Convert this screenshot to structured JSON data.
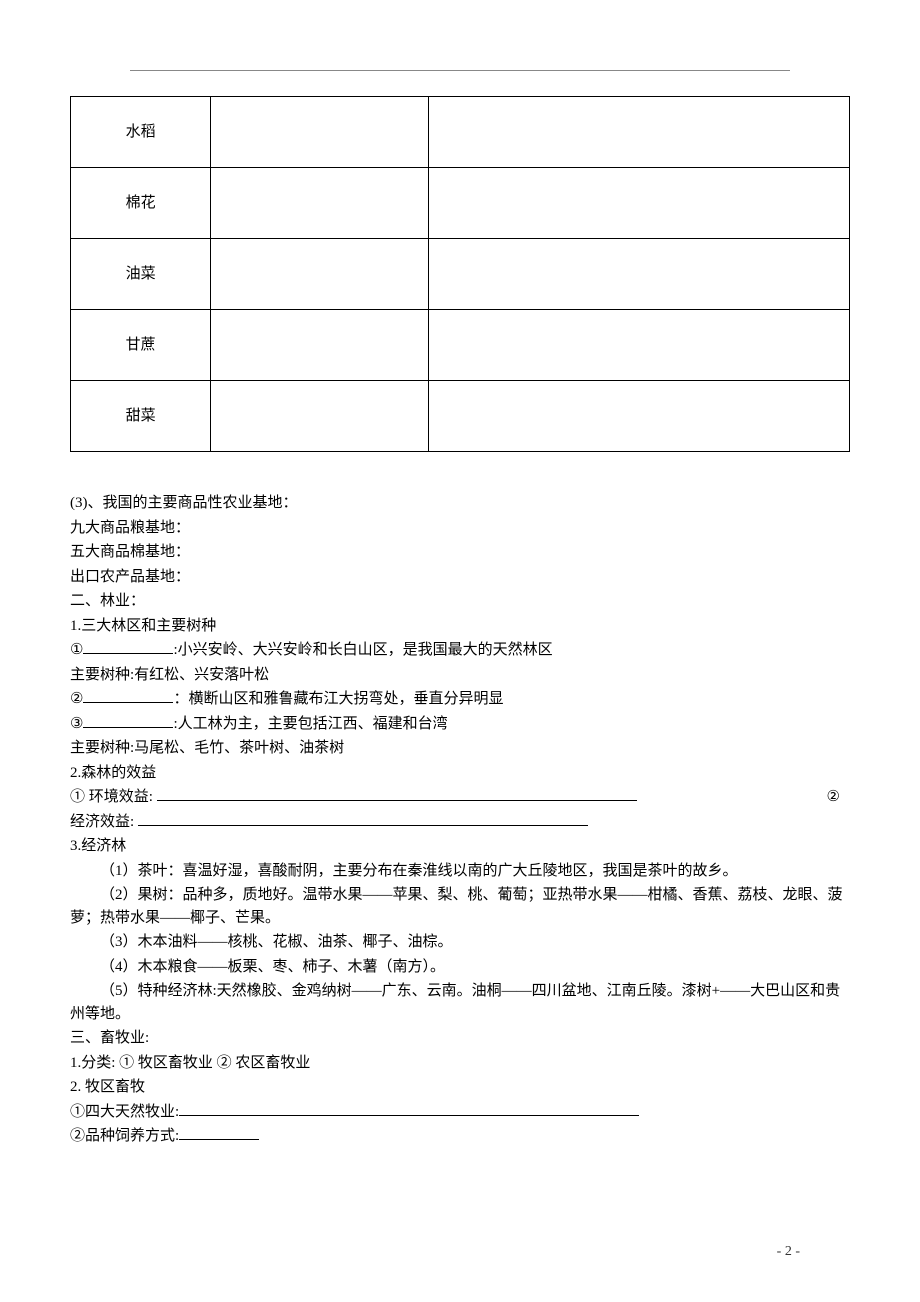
{
  "table": {
    "rows": [
      {
        "label": "水稻"
      },
      {
        "label": "棉花"
      },
      {
        "label": "油菜"
      },
      {
        "label": "甘蔗"
      },
      {
        "label": "甜菜"
      }
    ]
  },
  "section3": {
    "title": "(3)、我国的主要商品性农业基地：",
    "line1": "九大商品粮基地：",
    "line2": "五大商品棉基地：",
    "line3": "出口农产品基地："
  },
  "section_forestry": {
    "heading": "二、林业：",
    "sub1": "1.三大林区和主要树种",
    "item1_num": "①",
    "item1_body": ":小兴安岭、大兴安岭和长白山区，是我国最大的天然林区",
    "item1_trees": "主要树种:有红松、兴安落叶松",
    "item2_num": "②",
    "item2_body": "：横断山区和雅鲁藏布江大拐弯处，垂直分异明显",
    "item3_num": "③",
    "item3_body": ":人工林为主，主要包括江西、福建和台湾",
    "item3_trees": "主要树种:马尾松、毛竹、茶叶树、油茶树",
    "sub2": "2.森林的效益",
    "benefit1_label": "① 环境效益: ",
    "benefit1_right": "②",
    "benefit2_label": "经济效益:   ",
    "sub3": "3.经济林",
    "econ1": "（1）茶叶：喜温好湿，喜酸耐阴，主要分布在秦淮线以南的广大丘陵地区，我国是茶叶的故乡。",
    "econ2": "（2）果树：品种多，质地好。温带水果——苹果、梨、桃、葡萄；亚热带水果——柑橘、香蕉、荔枝、龙眼、菠萝；热带水果——椰子、芒果。",
    "econ3": "（3）木本油料——核桃、花椒、油茶、椰子、油棕。",
    "econ4": "（4）木本粮食——板栗、枣、柿子、木薯（南方）。",
    "econ5": "（5）特种经济林:天然橡胶、金鸡纳树——广东、云南。油桐——四川盆地、江南丘陵。漆树+——大巴山区和贵州等地。"
  },
  "section_husbandry": {
    "heading": "三、畜牧业:",
    "sub1": "1.分类: ① 牧区畜牧业 ② 农区畜牧业",
    "sub2": "2. 牧区畜牧",
    "item1_label": "①四大天然牧业:",
    "item2_label": "②品种饲养方式:"
  },
  "footer": {
    "page": "- 2 -"
  }
}
